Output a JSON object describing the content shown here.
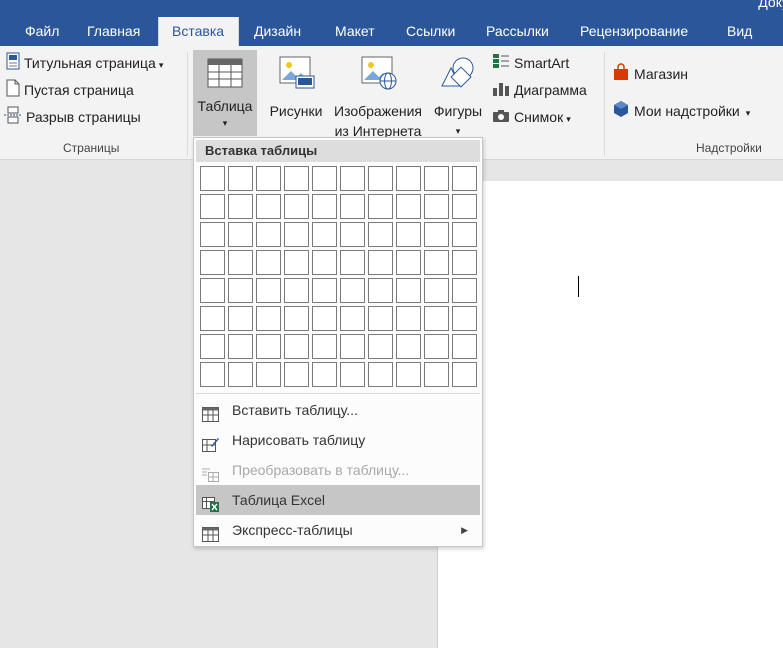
{
  "window": {
    "doc_title_fragment": "Доку"
  },
  "tabs": [
    {
      "label": "Файл"
    },
    {
      "label": "Главная"
    },
    {
      "label": "Вставка"
    },
    {
      "label": "Дизайн"
    },
    {
      "label": "Макет"
    },
    {
      "label": "Ссылки"
    },
    {
      "label": "Рассылки"
    },
    {
      "label": "Рецензирование"
    },
    {
      "label": "Вид"
    }
  ],
  "active_tab": "Вставка",
  "ribbon": {
    "pages_group": {
      "cover_page": "Титульная страница",
      "blank_page": "Пустая страница",
      "page_break": "Разрыв страницы",
      "label": "Страницы"
    },
    "table_button": "Таблица",
    "pictures": "Рисунки",
    "online_pictures_line1": "Изображения",
    "online_pictures_line2": "из Интернета",
    "shapes": "Фигуры",
    "smartart": "SmartArt",
    "chart": "Диаграмма",
    "screenshot": "Снимок",
    "store": "Магазин",
    "my_addins": "Мои надстройки",
    "addins_label": "Надстройки"
  },
  "dropdown": {
    "header": "Вставка таблицы",
    "grid": {
      "columns": 10,
      "rows": 8
    },
    "items": [
      {
        "label": "Вставить таблицу...",
        "enabled": true,
        "highlighted": false,
        "icon": "insert-table-icon"
      },
      {
        "label": "Нарисовать таблицу",
        "enabled": true,
        "highlighted": false,
        "icon": "draw-table-icon"
      },
      {
        "label": "Преобразовать в таблицу...",
        "enabled": false,
        "highlighted": false,
        "icon": "convert-to-table-icon"
      },
      {
        "label": "Таблица Excel",
        "enabled": true,
        "highlighted": true,
        "icon": "excel-table-icon"
      },
      {
        "label": "Экспресс-таблицы",
        "enabled": true,
        "highlighted": false,
        "icon": "quick-tables-icon",
        "submenu": true
      }
    ]
  },
  "colors": {
    "title_bar": "#2b579a",
    "ribbon_bg": "#f3f3f3",
    "store_red": "#d83b01",
    "excel_green": "#217346",
    "addins_blue": "#2b579a"
  }
}
